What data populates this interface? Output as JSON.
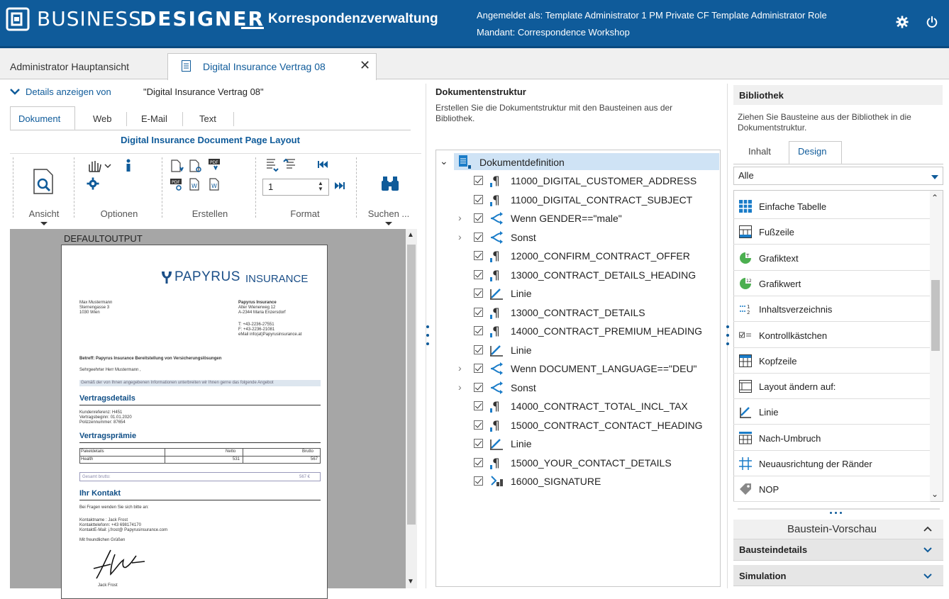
{
  "header": {
    "brand_business": "BUSINESS",
    "brand_designer": "DESIGNER",
    "app_name": "Korrespondenzverwaltung",
    "login_line1": "Angemeldet als:  Template Administrator 1   PM Private CF Template Administrator Role",
    "login_line2": "Mandant:  Correspondence Workshop",
    "icons": [
      "gear-icon",
      "power-icon"
    ]
  },
  "tabs": [
    {
      "label": "Administrator Hauptansicht",
      "active": false
    },
    {
      "label": "Digital Insurance Vertrag 08",
      "active": true,
      "closable": true
    }
  ],
  "left": {
    "details_label": "Details anzeigen von",
    "details_value": "\"Digital Insurance Vertrag 08\"",
    "subtabs": [
      "Dokument",
      "Web",
      "E-Mail",
      "Text"
    ],
    "layout_title": "Digital Insurance Document Page Layout",
    "ribbon_groups": [
      "Ansicht",
      "Optionen",
      "Erstellen",
      "Format",
      "Suchen ..."
    ],
    "page_input_value": "1",
    "preview": {
      "defaultoutput": "DEFAULTOUTPUT",
      "logo_text": "PAPYRUS",
      "logo_text2": "INSURANCE",
      "addr_left": [
        "Max Mustermann",
        "Sternengasse 3",
        "1030 Wien"
      ],
      "addr_right": [
        "Papyrus Insurance",
        "Alter Wienerweg 12",
        "A-2344 Maria Enzersdorf"
      ],
      "contact_right": [
        "T: +43-2236-27551",
        "F: +43-2236-21081",
        "eMail info(at)Papyrusinsurance.at"
      ],
      "betreff": "Betreff: Papyrus Insurance Bereitstellung von Versicherungslösungen",
      "salutation": "Sehrgeehrter Herr Mustermann ,",
      "intro": "Gemäß der von Ihnen angegebenen Informationen unterbreiten wir Ihnen gerne das folgende Angebot",
      "h_vertragsdetails": "Vertragsdetails",
      "vertrag_lines": [
        "Kundenreferenz: H451",
        "Vertragsbeginn: 01.01.2020",
        "Polizzennummer: 87654"
      ],
      "h_vertragspraemie": "Vertragsprämie",
      "table_headers": [
        "Paketdetails",
        "Netto",
        "Brutto"
      ],
      "table_row": [
        "Health",
        "531",
        "567"
      ],
      "gesamt_label": "Gesamt brutto:",
      "gesamt_value": "567 €",
      "h_kontakt": "Ihr Kontakt",
      "kontakt_intro": "Bei Fragen wenden Sie sich bitte an:",
      "kontakt_lines": [
        "Kontaktname : Jack Frost",
        "Kontakttelefonn: +43 698174170",
        "KontaktE-Mail: j.frost@ Papyrusinsurance.com"
      ],
      "gruesse": "Mit freundlichen Grüßen",
      "signature_name": "Jack Frost"
    }
  },
  "middle": {
    "title": "Dokumentenstruktur",
    "desc": "Erstellen Sie die Dokumentstruktur mit den Bausteinen aus der Bibliothek.",
    "root": "Dokumentdefinition",
    "items": [
      {
        "label": "11000_DIGITAL_CUSTOMER_ADDRESS",
        "icon": "paragraph-icon",
        "expandable": false
      },
      {
        "label": "11000_DIGITAL_CONTRACT_SUBJECT",
        "icon": "paragraph-icon",
        "expandable": false
      },
      {
        "label": "Wenn GENDER==\"male\"",
        "icon": "condition-icon",
        "expandable": true
      },
      {
        "label": "Sonst",
        "icon": "condition-icon",
        "expandable": true
      },
      {
        "label": "12000_CONFIRM_CONTRACT_OFFER",
        "icon": "paragraph-icon",
        "expandable": false
      },
      {
        "label": "13000_CONTRACT_DETAILS_HEADING",
        "icon": "paragraph-icon",
        "expandable": false
      },
      {
        "label": "Linie",
        "icon": "line-icon",
        "expandable": false
      },
      {
        "label": "13000_CONTRACT_DETAILS",
        "icon": "paragraph-icon",
        "expandable": false
      },
      {
        "label": "14000_CONTRACT_PREMIUM_HEADING",
        "icon": "paragraph-icon",
        "expandable": false
      },
      {
        "label": "Linie",
        "icon": "line-icon",
        "expandable": false
      },
      {
        "label": "Wenn DOCUMENT_LANGUAGE==\"DEU\"",
        "icon": "condition-icon",
        "expandable": true
      },
      {
        "label": "Sonst",
        "icon": "condition-icon",
        "expandable": true
      },
      {
        "label": "14000_CONTRACT_TOTAL_INCL_TAX",
        "icon": "paragraph-icon",
        "expandable": false
      },
      {
        "label": "15000_CONTRACT_CONTACT_HEADING",
        "icon": "paragraph-icon",
        "expandable": false
      },
      {
        "label": "Linie",
        "icon": "line-icon",
        "expandable": false
      },
      {
        "label": "15000_YOUR_CONTACT_DETAILS",
        "icon": "paragraph-icon",
        "expandable": false
      },
      {
        "label": "16000_SIGNATURE",
        "icon": "signature-icon",
        "expandable": false
      }
    ]
  },
  "right": {
    "title": "Bibliothek",
    "desc": "Ziehen Sie Bausteine aus der Bibliothek in die Dokumentstruktur.",
    "tabs": [
      "Inhalt",
      "Design"
    ],
    "filter_value": "Alle",
    "items": [
      {
        "label": "Einfache Tabelle",
        "icon": "table-icon"
      },
      {
        "label": "Fußzeile",
        "icon": "footer-icon"
      },
      {
        "label": "Grafiktext",
        "icon": "chart-text-icon"
      },
      {
        "label": "Grafikwert",
        "icon": "chart-value-icon"
      },
      {
        "label": "Inhaltsverzeichnis",
        "icon": "toc-icon"
      },
      {
        "label": "Kontrollkästchen",
        "icon": "checkbox-icon"
      },
      {
        "label": "Kopfzeile",
        "icon": "header-icon"
      },
      {
        "label": "Layout ändern auf:",
        "icon": "layout-icon"
      },
      {
        "label": "Linie",
        "icon": "line-icon"
      },
      {
        "label": "Nach-Umbruch",
        "icon": "break-icon"
      },
      {
        "label": "Neuausrichtung der Ränder",
        "icon": "margins-icon"
      },
      {
        "label": "NOP",
        "icon": "tag-icon"
      }
    ],
    "preview_title": "Baustein-Vorschau",
    "accordions": [
      "Bausteindetails",
      "Simulation"
    ]
  },
  "colors": {
    "brand": "#0f5b9a",
    "accent": "#1a7cc8",
    "selection": "#cfe3f5"
  }
}
